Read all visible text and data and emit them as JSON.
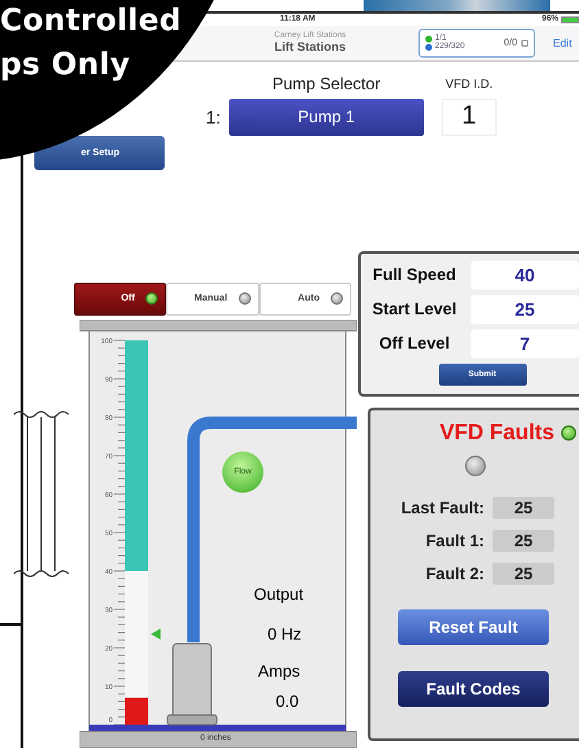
{
  "banner": {
    "lines": [
      "Controlled",
      "ps Only"
    ]
  },
  "status_bar": {
    "time": "11:18 AM",
    "battery": "96%"
  },
  "nav": {
    "subtitle": "Carney Lift Stations",
    "title": "Lift Stations",
    "stations": "1/1",
    "points": "229/320",
    "alarms": "0/0",
    "edit": "Edit"
  },
  "side_buttons": [
    {
      "label": "er Setup"
    }
  ],
  "pump": {
    "row_label": "1:",
    "selector_label": "Pump Selector",
    "selected": "Pump 1",
    "vfd_label": "VFD I.D.",
    "vfd_id": "1"
  },
  "modes": [
    {
      "label": "Off",
      "selected": true
    },
    {
      "label": "Manual",
      "selected": false
    },
    {
      "label": "Auto",
      "selected": false
    }
  ],
  "tank": {
    "scale": [
      "100",
      "90",
      "80",
      "70",
      "60",
      "50",
      "40",
      "30",
      "20",
      "10",
      "0"
    ],
    "level": 0.07,
    "flow": "Flow",
    "flow_on": true,
    "output_label": "Output",
    "output": "0 Hz",
    "amps_label": "Amps",
    "amps": "0.0",
    "depth": "0 inches"
  },
  "settings": {
    "rows": [
      {
        "label": "Full Speed",
        "value": "40"
      },
      {
        "label": "Start Level",
        "value": "25"
      },
      {
        "label": "Off Level",
        "value": "7"
      }
    ],
    "submit": "Submit"
  },
  "faults": {
    "title": "VFD Faults",
    "ok": true,
    "alarm": false,
    "rows": [
      {
        "label": "Last Fault:",
        "value": "25"
      },
      {
        "label": "Fault 1:",
        "value": "25"
      },
      {
        "label": "Fault 2:",
        "value": "25"
      }
    ],
    "buttons": [
      "Reset Fault",
      "Fault Codes"
    ]
  }
}
